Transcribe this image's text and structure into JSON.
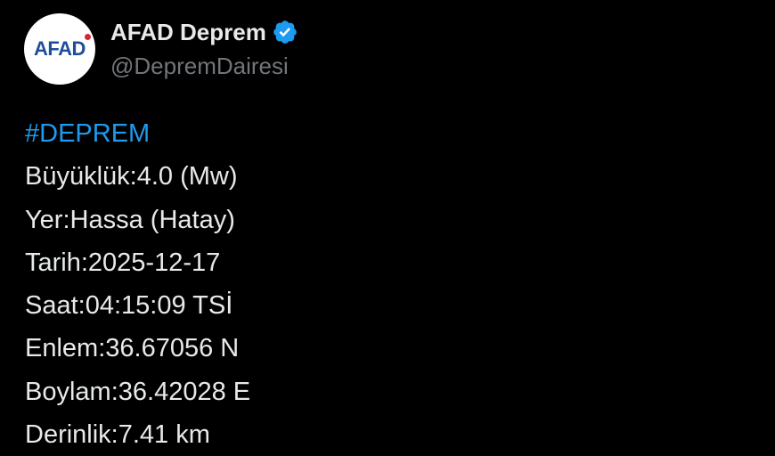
{
  "account": {
    "display_name": "AFAD Deprem",
    "handle": "@DepremDairesi",
    "avatar_text": "AFAD",
    "verified_icon": "verified-badge-icon"
  },
  "tweet": {
    "hashtag": "#DEPREM",
    "lines": [
      "Büyüklük:4.0 (Mw)",
      "Yer:Hassa (Hatay)",
      "Tarih:2025-12-17",
      "Saat:04:15:09 TSİ",
      "Enlem:36.67056 N",
      "Boylam:36.42028 E",
      "Derinlik:7.41 km"
    ]
  },
  "colors": {
    "background": "#000000",
    "text": "#e7e9ea",
    "muted": "#71767b",
    "link": "#1d9bf0",
    "verified": "#1d9bf0",
    "logo_blue": "#1f4e9c",
    "logo_red": "#d7262e"
  }
}
